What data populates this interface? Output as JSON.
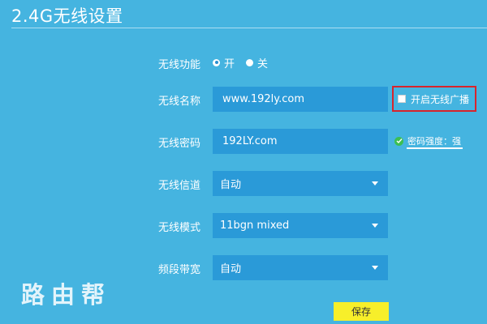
{
  "page": {
    "title": "2.4G无线设置"
  },
  "wireless_function": {
    "label": "无线功能",
    "on": "开",
    "off": "关",
    "selected": "开"
  },
  "ssid": {
    "label": "无线名称",
    "value": "www.192ly.com",
    "broadcast_label": "开启无线广播",
    "broadcast_checked": false
  },
  "password": {
    "label": "无线密码",
    "value": "192LY.com",
    "strength_text": "密码强度：强"
  },
  "channel": {
    "label": "无线信道",
    "value": "自动"
  },
  "mode": {
    "label": "无线模式",
    "value": "11bgn mixed"
  },
  "bandwidth": {
    "label": "频段带宽",
    "value": "自动"
  },
  "watermark": "路由帮",
  "save_label": "保存",
  "colors": {
    "background": "#45b4e0",
    "field": "#2a9ad8",
    "highlight": "#d8242c",
    "save": "#f7ef2a",
    "ok": "#3cbf53"
  }
}
